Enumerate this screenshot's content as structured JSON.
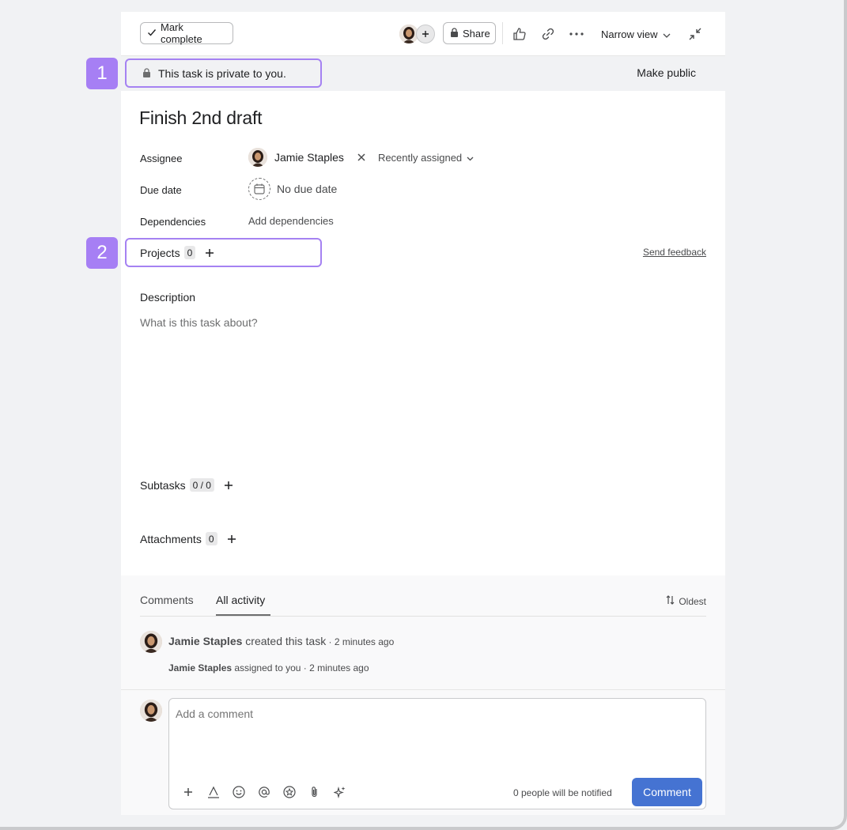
{
  "toolbar": {
    "mark_complete": "Mark complete",
    "share": "Share",
    "view_mode": "Narrow view"
  },
  "privacy": {
    "message": "This task is private to you.",
    "make_public": "Make public"
  },
  "callouts": [
    "1",
    "2"
  ],
  "task": {
    "title": "Finish 2nd draft",
    "fields": {
      "assignee_label": "Assignee",
      "assignee_name": "Jamie Staples",
      "recently_assigned": "Recently assigned",
      "due_label": "Due date",
      "due_value": "No due date",
      "deps_label": "Dependencies",
      "deps_link": "Add dependencies"
    },
    "projects_label": "Projects",
    "projects_count": "0",
    "send_feedback": "Send feedback",
    "description_label": "Description",
    "description_placeholder": "What is this task about?",
    "subtasks_label": "Subtasks",
    "subtasks_count": "0 / 0",
    "attachments_label": "Attachments",
    "attachments_count": "0"
  },
  "activity": {
    "tabs": [
      "Comments",
      "All activity"
    ],
    "active_tab": "All activity",
    "sort": "Oldest",
    "entries": [
      {
        "actor": "Jamie Staples",
        "action": " created this task",
        "time": " · 2 minutes ago"
      },
      {
        "actor": "Jamie Staples",
        "action": " assigned to you",
        "time": " · 2 minutes ago"
      }
    ]
  },
  "comment": {
    "placeholder": "Add a comment",
    "notify": "0 people will be notified",
    "submit": "Comment"
  },
  "colors": {
    "accent_purple": "#a67ff4",
    "primary_blue": "#4573d2"
  }
}
